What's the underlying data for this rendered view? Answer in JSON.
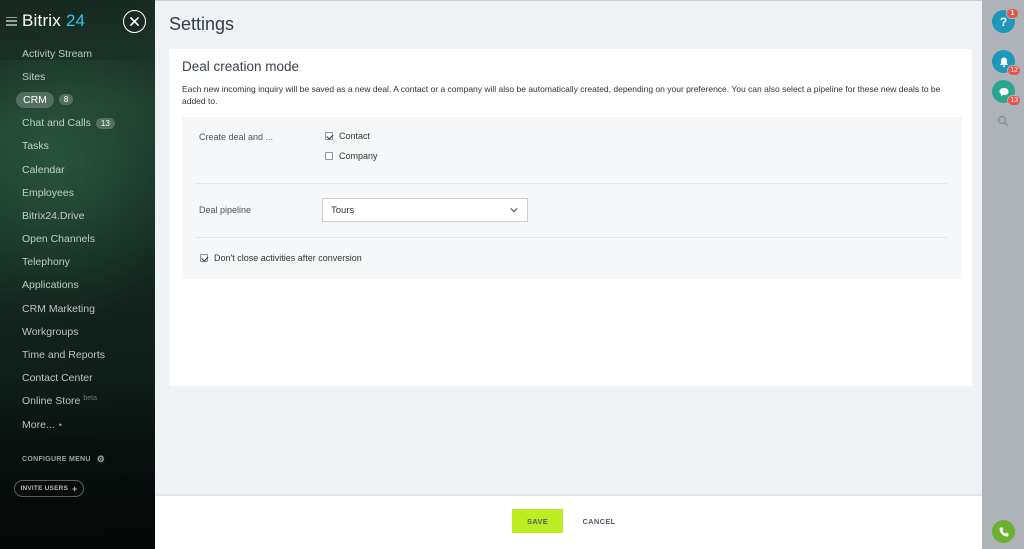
{
  "brand": {
    "name": "Bitrix",
    "number": "24"
  },
  "sidebar": {
    "items": [
      {
        "label": "Activity Stream"
      },
      {
        "label": "Sites"
      },
      {
        "label": "CRM",
        "counter": "8"
      },
      {
        "label": "Chat and Calls",
        "counter": "13"
      },
      {
        "label": "Tasks"
      },
      {
        "label": "Calendar"
      },
      {
        "label": "Employees"
      },
      {
        "label": "Bitrix24.Drive"
      },
      {
        "label": "Open Channels"
      },
      {
        "label": "Telephony"
      },
      {
        "label": "Applications"
      },
      {
        "label": "CRM Marketing"
      },
      {
        "label": "Workgroups"
      },
      {
        "label": "Time and Reports"
      },
      {
        "label": "Contact Center"
      },
      {
        "label": "Online Store",
        "note": "beta"
      },
      {
        "label": "More..."
      }
    ],
    "configure_label": "CONFIGURE MENU",
    "invite_label": "INVITE USERS"
  },
  "panel": {
    "title": "Settings",
    "section_title": "Deal creation mode",
    "description": "Each new incoming inquiry will be saved as a new deal. A contact or a company will also be automatically created, depending on your preference. You can also select a pipeline for these new deals to be added to.",
    "create_label": "Create deal and ...",
    "options": [
      {
        "label": "Contact",
        "checked": true
      },
      {
        "label": "Company",
        "checked": false
      }
    ],
    "pipeline_label": "Deal pipeline",
    "pipeline_value": "Tours",
    "dont_close_label": "Don't close activities after conversion",
    "dont_close_checked": true
  },
  "footer": {
    "save_label": "SAVE",
    "cancel_label": "CANCEL"
  },
  "rail": {
    "help_label": "?",
    "help_badge": "1",
    "notifications_badge": "12",
    "chat_badge": "13"
  },
  "colors": {
    "accent_green": "#bbed21",
    "brand_blue": "#2fc6f6",
    "rail_blue": "#1f97b8",
    "badge_red": "#e8524a"
  }
}
